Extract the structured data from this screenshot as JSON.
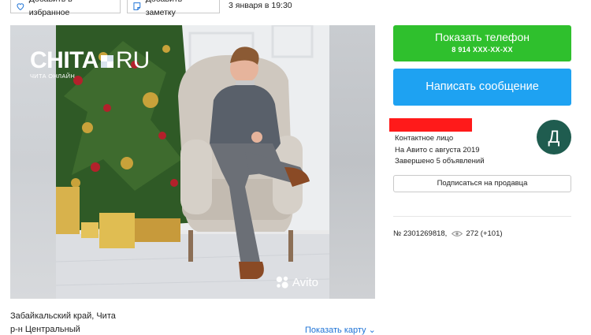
{
  "toolbar": {
    "favorite_label": "Добавить в избранное",
    "note_label": "Добавить заметку",
    "date": "3 января в 19:30"
  },
  "photo": {
    "watermark_title": "CHITA",
    "watermark_tld": "RU",
    "watermark_sub": "ЧИТА ОНЛАЙН",
    "avito_label": "Avito"
  },
  "contact": {
    "show_phone_label": "Показать телефон",
    "phone_masked": "8 914 XXX-XX-XX",
    "write_message_label": "Написать сообщение"
  },
  "seller": {
    "role": "Контактное лицо",
    "since": "На Авито с августа 2019",
    "completed": "Завершено 5 объявлений",
    "avatar_letter": "Д",
    "subscribe_label": "Подписаться на продавца"
  },
  "ad": {
    "number": "№ 2301269818,",
    "views": "272 (+101)"
  },
  "location": {
    "region": "Забайкальский край, Чита",
    "district": "р-н Центральный",
    "map_link": "Показать карту"
  },
  "colors": {
    "phone_button": "#2fc02d",
    "message_button": "#1ea2f2",
    "redaction": "#ff1a1a",
    "avatar": "#1f5c4f",
    "link": "#1e73d6"
  }
}
